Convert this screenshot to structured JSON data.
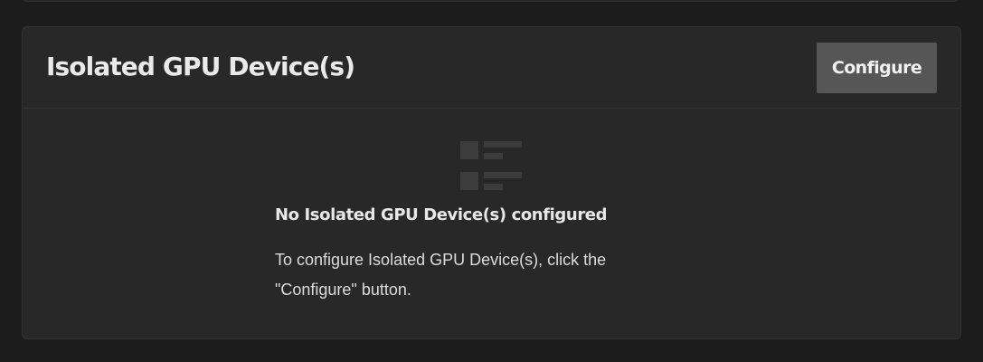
{
  "card": {
    "title": "Isolated GPU Device(s)",
    "configure_label": "Configure"
  },
  "empty_state": {
    "icon": "list-icon",
    "title": "No Isolated GPU Device(s) configured",
    "message": "To configure Isolated GPU Device(s), click the \"Configure\" button."
  }
}
